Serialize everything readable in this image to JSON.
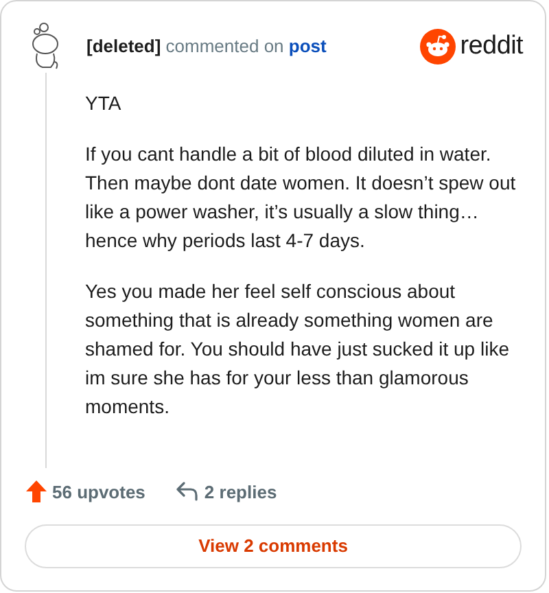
{
  "header": {
    "author": "[deleted]",
    "action": "commented on",
    "link": "post"
  },
  "brand": {
    "wordmark": "reddit"
  },
  "comment": {
    "paragraphs": [
      "YTA",
      "If you cant handle a bit of blood diluted in water. Then maybe dont date women. It doesn’t spew out like a power washer, it’s usually a slow thing… hence why periods last 4-7 days.",
      "Yes you made her feel self conscious about something that is already something women are shamed for. You should have just sucked it up like im sure she has for your less than glamorous moments."
    ]
  },
  "footer": {
    "upvotes": "56 upvotes",
    "replies": "2 replies"
  },
  "button": {
    "label": "View 2 comments"
  }
}
